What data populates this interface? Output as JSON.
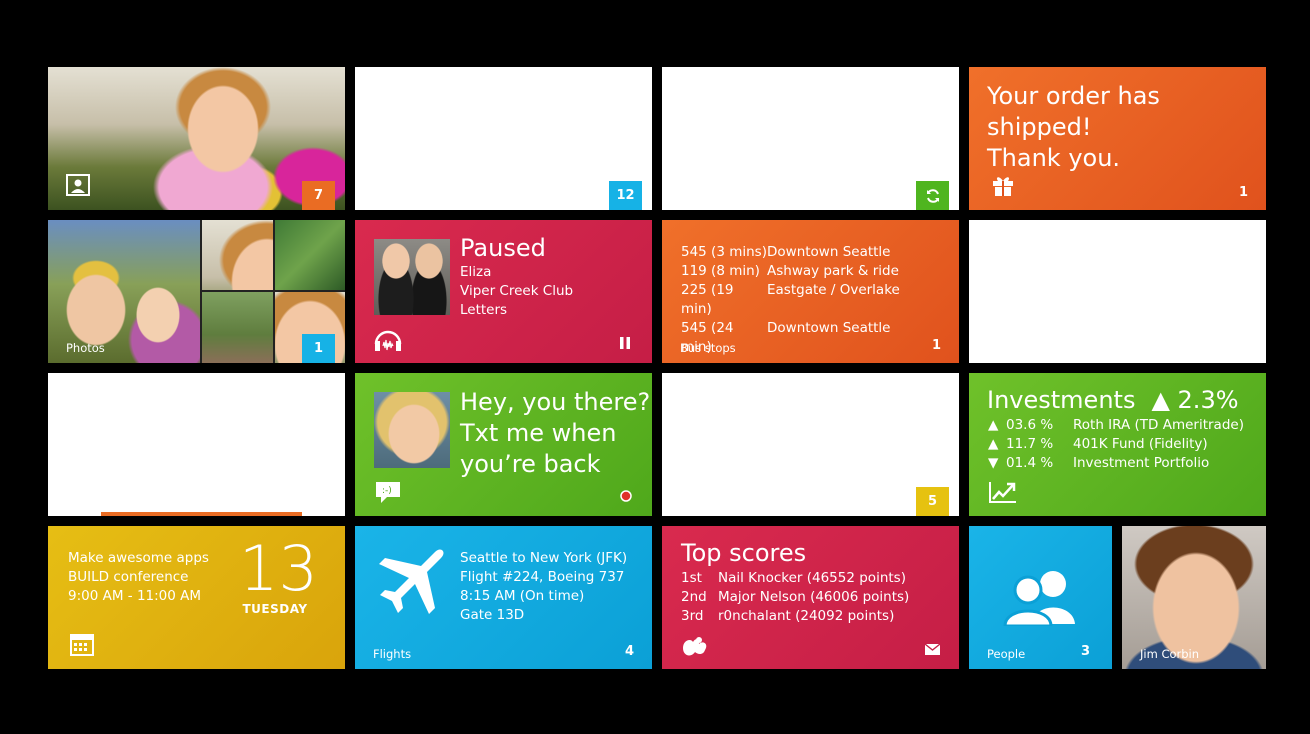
{
  "tiles": {
    "photos_single": {
      "badge": "7",
      "badge_color": "#ea6c23"
    },
    "blank1": {
      "badge": "12",
      "badge_color": "#16b2e6"
    },
    "blank2": {
      "badge_icon": "refresh-icon",
      "badge_color": "#4fb51f"
    },
    "order": {
      "line1": "Your order has shipped!",
      "line2": "Thank you.",
      "count": "1",
      "icon": "gift-icon"
    },
    "photos_collage": {
      "label": "Photos",
      "badge": "1",
      "badge_color": "#16b2e6"
    },
    "music": {
      "status": "Paused",
      "artist": "Eliza",
      "album": "Viper Creek Club",
      "track": "Letters",
      "icon": "headphones-icon",
      "control": "pause-icon"
    },
    "bus": {
      "rows": [
        {
          "time": "545 (3 mins)",
          "dest": "Downtown Seattle"
        },
        {
          "time": "119 (8 min)",
          "dest": "Ashway park & ride"
        },
        {
          "time": "225 (19 min)",
          "dest": "Eastgate / Overlake"
        },
        {
          "time": "545 (24 min)",
          "dest": "Downtown Seattle"
        }
      ],
      "label": "Bus stops",
      "count": "1"
    },
    "message": {
      "line1": "Hey, you there?",
      "line2": "Txt me when",
      "line3": "you’re back",
      "icon": "chat-icon"
    },
    "blank5": {
      "badge": "5",
      "badge_color": "#e6c210"
    },
    "investments": {
      "title": "Investments",
      "change": "▲ 2.3%",
      "rows": [
        {
          "dir": "▲",
          "pct": "03.6 %",
          "name": "Roth IRA (TD Ameritrade)"
        },
        {
          "dir": "▲",
          "pct": "11.7 %",
          "name": "401K Fund (Fidelity)"
        },
        {
          "dir": "▼",
          "pct": "01.4 %",
          "name": "Investment Portfolio"
        }
      ]
    },
    "calendar": {
      "line1": "Make awesome apps",
      "line2": "BUILD conference",
      "line3": "9:00 AM - 11:00 AM",
      "day": "13",
      "weekday": "TUESDAY"
    },
    "flights": {
      "line1": "Seattle to New York (JFK)",
      "line2": "Flight #224, Boeing 737",
      "line3": "8:15 AM (On time)",
      "line4": "Gate 13D",
      "label": "Flights",
      "count": "4"
    },
    "scores": {
      "title": "Top scores",
      "rows": [
        {
          "rank": "1st",
          "entry": "Nail Knocker  (46552 points)"
        },
        {
          "rank": "2nd",
          "entry": "Major Nelson  (46006 points)"
        },
        {
          "rank": "3rd",
          "entry": "r0nchalant  (24092 points)"
        }
      ]
    },
    "people": {
      "label": "People",
      "count": "3"
    },
    "contact": {
      "name": "Jim Corbin"
    }
  }
}
